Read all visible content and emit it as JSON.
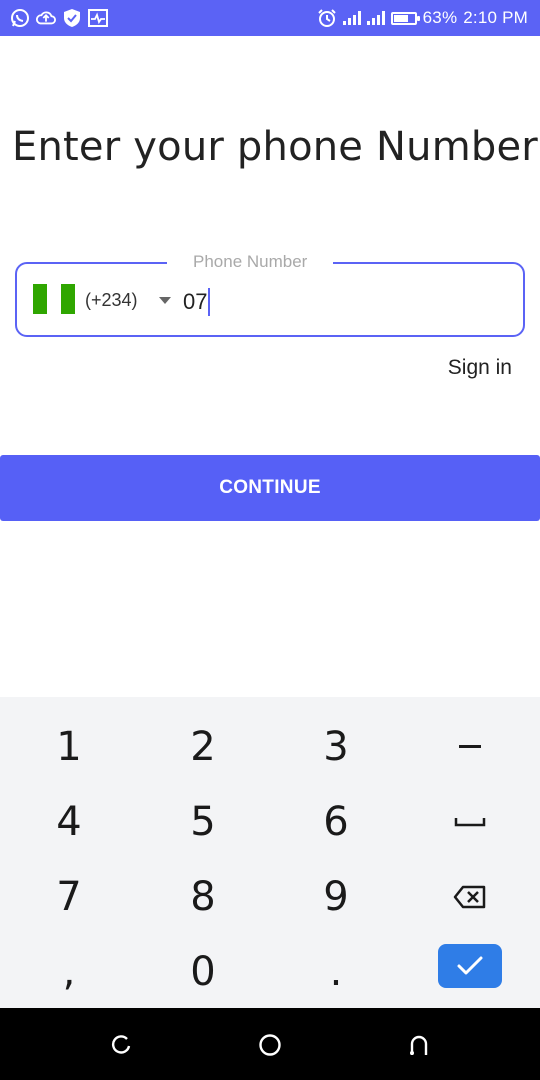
{
  "status_bar": {
    "icons_left": [
      "whatsapp-icon",
      "cloud-upload-icon",
      "shield-check-icon",
      "activity-icon"
    ],
    "alarm_icon": "alarm-icon",
    "battery_percent": "63%",
    "battery_level": 0.63,
    "time": "2:10 PM"
  },
  "title": "Enter your phone Number",
  "phone_field": {
    "legend": "Phone Number",
    "country_flag": "nigeria-flag-icon",
    "dial_code": "(+234)",
    "value": "07"
  },
  "sign_in": "Sign in",
  "continue_button": "CONTINUE",
  "keypad": {
    "keys": [
      "1",
      "2",
      "3",
      "–",
      "4",
      "5",
      "6",
      "␣",
      "7",
      "8",
      "9",
      "⌫",
      ",",
      "0",
      "."
    ],
    "done_icon": "check-icon",
    "accent": "#2f7de7"
  },
  "colors": {
    "primary": "#5b63f5",
    "button": "#5660f6",
    "flag_green": "#2fa600"
  },
  "nav_bar": {
    "recent": "recent-apps-icon",
    "home": "home-icon",
    "back": "back-icon"
  }
}
